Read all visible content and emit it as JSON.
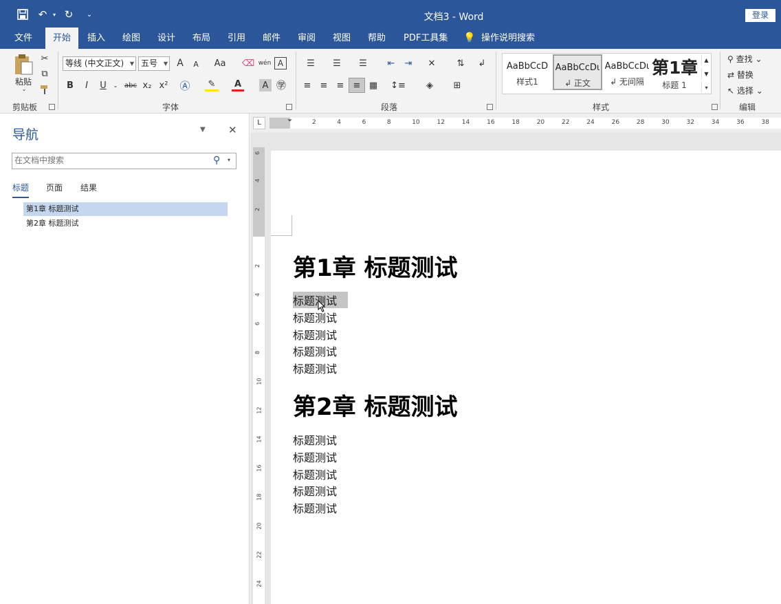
{
  "titlebar": {
    "title": "文档3  -  Word",
    "login": "登录",
    "undo": "↶",
    "redo": "↻",
    "qat_more": "⌄"
  },
  "tabs": [
    "文件",
    "开始",
    "插入",
    "绘图",
    "设计",
    "布局",
    "引用",
    "邮件",
    "审阅",
    "视图",
    "帮助",
    "PDF工具集"
  ],
  "tell_me": "操作说明搜索",
  "ribbon": {
    "clipboard": {
      "label": "剪贴板",
      "paste": "粘贴"
    },
    "font": {
      "label": "字体",
      "font_name": "等线 (中文正文)",
      "font_size": "五号",
      "bold": "B",
      "italic": "I",
      "underline": "U",
      "strike": "abc",
      "sub": "x₂",
      "sup": "x²",
      "grow": "A",
      "shrink": "A",
      "case": "Aa",
      "phonetic": "wén",
      "border_char": "A"
    },
    "paragraph": {
      "label": "段落"
    },
    "styles": {
      "label": "样式",
      "items": [
        {
          "preview": "AaBbCcD",
          "name": "样式1"
        },
        {
          "preview": "AaBbCcDι",
          "name": "↲ 正文"
        },
        {
          "preview": "AaBbCcDι",
          "name": "↲ 无间隔"
        },
        {
          "preview": "第1章",
          "name": "标题 1"
        }
      ]
    },
    "editing": {
      "label": "编辑",
      "find": "查找",
      "replace": "替换",
      "select": "选择"
    }
  },
  "nav": {
    "title": "导航",
    "search_placeholder": "在文档中搜索",
    "tabs": [
      "标题",
      "页面",
      "结果"
    ],
    "headings": [
      "第1章 标题测试",
      "第2章 标题测试"
    ]
  },
  "ruler": {
    "h_ticks": [
      "2",
      "4",
      "6",
      "8",
      "10",
      "12",
      "14",
      "16",
      "18",
      "20",
      "22",
      "24",
      "26",
      "28",
      "30",
      "32",
      "34",
      "36",
      "38"
    ],
    "v_ticks": [
      "6",
      "4",
      "2",
      "2",
      "4",
      "6",
      "8",
      "10",
      "12",
      "14",
      "16",
      "18",
      "20",
      "22",
      "24"
    ],
    "corner": "L"
  },
  "document": {
    "chapter1": "第1章 标题测试",
    "chapter1_lines": [
      "标题测试",
      "标题测试",
      "标题测试",
      "标题测试",
      "标题测试"
    ],
    "chapter2": "第2章 标题测试",
    "chapter2_lines": [
      "标题测试",
      "标题测试",
      "标题测试",
      "标题测试",
      "标题测试"
    ]
  },
  "colors": {
    "accent": "#2b579a",
    "ribbon_bg": "#f3f3f3",
    "selection": "#c5d6ef",
    "text_highlight": "#c5c5c5"
  }
}
